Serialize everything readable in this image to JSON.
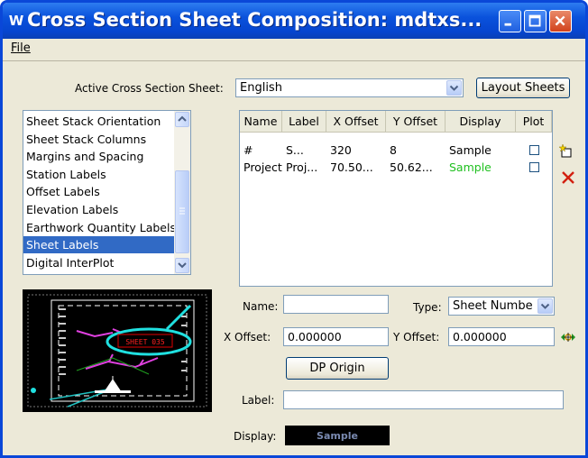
{
  "window": {
    "title": "Cross Section Sheet Composition: mdtxs...",
    "app_icon": "W",
    "colors": {
      "titlebar": "#0a52dc",
      "face": "#ece9d8",
      "selection": "#316ac5",
      "display_green": "#20c020"
    }
  },
  "menu": {
    "file": "File"
  },
  "active_sheet": {
    "label": "Active Cross Section Sheet:",
    "value": "English",
    "layout_button": "Layout Sheets"
  },
  "categories": [
    {
      "label": "Sheet Stack Orientation",
      "selected": false
    },
    {
      "label": "Sheet Stack Columns",
      "selected": false
    },
    {
      "label": "Margins and Spacing",
      "selected": false
    },
    {
      "label": "Station Labels",
      "selected": false
    },
    {
      "label": "Offset Labels",
      "selected": false
    },
    {
      "label": "Elevation Labels",
      "selected": false
    },
    {
      "label": "Earthwork Quantity Labels",
      "selected": false
    },
    {
      "label": "Sheet Labels",
      "selected": true
    },
    {
      "label": "Digital InterPlot",
      "selected": false
    }
  ],
  "table": {
    "headers": [
      "Name",
      "Label",
      "X Offset",
      "Y Offset",
      "Display",
      "Plot"
    ],
    "rows": [
      {
        "name": "#",
        "label": "S...",
        "x_offset": "320",
        "y_offset": "8",
        "display": "Sample",
        "display_color": "black",
        "plot": false
      },
      {
        "name": "Project",
        "label": "Proj...",
        "x_offset": "70.50...",
        "y_offset": "50.62...",
        "display": "Sample",
        "display_color": "green",
        "plot": false
      }
    ]
  },
  "side_icons": {
    "add": "add-row-icon",
    "delete": "delete-icon"
  },
  "form": {
    "name_label": "Name:",
    "name_value": "",
    "type_label": "Type:",
    "type_value": "Sheet Numbe",
    "x_offset_label": "X Offset:",
    "x_offset_value": "0.000000",
    "y_offset_label": "Y Offset:",
    "y_offset_value": "0.000000",
    "dp_origin_button": "DP Origin",
    "label_label": "Label:",
    "label_value": "",
    "display_label": "Display:",
    "display_sample": "Sample"
  },
  "preview": {
    "sheet_text": "SHEET 035"
  }
}
